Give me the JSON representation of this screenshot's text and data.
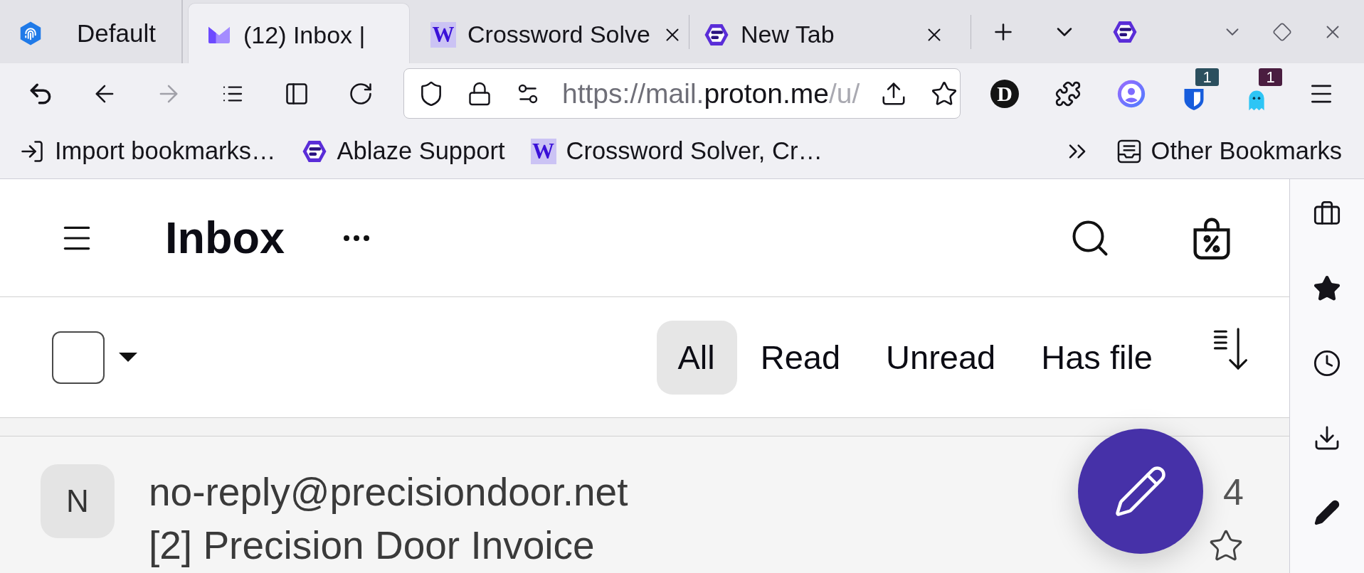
{
  "browser": {
    "workspace": {
      "label": "Default"
    },
    "tabs": [
      {
        "title": "(12) Inbox |",
        "kind": "mail",
        "selected": true,
        "closable": false
      },
      {
        "title": "Crossword Solve",
        "kind": "letter",
        "favicon_text": "W",
        "selected": false,
        "closable": true
      },
      {
        "title": "New Tab",
        "kind": "ablaze",
        "selected": false,
        "closable": true
      }
    ],
    "navigation": {
      "back_disabled": false,
      "forward_disabled": true
    },
    "address": {
      "prefix": "https://mail.",
      "domain": "proton.me",
      "suffix": "/u/"
    },
    "extension_logo_text": "D",
    "extension_badges": [
      "1",
      "1"
    ],
    "bookmarks": [
      {
        "label": "Import bookmarks…",
        "kind": "import"
      },
      {
        "label": "Ablaze Support",
        "kind": "ablaze"
      },
      {
        "label": "Crossword Solver, Cr…",
        "kind": "letter",
        "favicon_text": "W"
      }
    ],
    "other_bookmarks": "Other Bookmarks"
  },
  "mail": {
    "title": "Inbox",
    "select_all": {
      "checked": false
    },
    "filters": [
      {
        "label": "All",
        "selected": true
      },
      {
        "label": "Read",
        "selected": false
      },
      {
        "label": "Unread",
        "selected": false
      },
      {
        "label": "Has file",
        "selected": false
      }
    ],
    "messages": [
      {
        "avatar": "N",
        "sender": "no-reply@precisiondoor.net",
        "subject": "[2] Precision Door Invoice",
        "date": "4",
        "starred": false,
        "unread": false
      }
    ]
  }
}
